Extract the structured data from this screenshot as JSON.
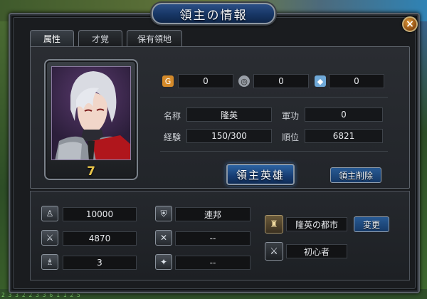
{
  "window": {
    "title": "領主の情報",
    "close_symbol": "×"
  },
  "background": {
    "corner_text": "2 3 3 2 2 3 3 6 1 1 2 5"
  },
  "tabs": [
    {
      "label": "属性",
      "active": true
    },
    {
      "label": "才覚",
      "active": false
    },
    {
      "label": "保有領地",
      "active": false
    }
  ],
  "portrait": {
    "level": "7"
  },
  "resources": [
    {
      "icon": "gold-coin-icon",
      "value": "0"
    },
    {
      "icon": "stone-icon",
      "value": "0"
    },
    {
      "icon": "crystal-icon",
      "value": "0"
    }
  ],
  "info": {
    "name_label": "名称",
    "name_value": "隆英",
    "merit_label": "軍功",
    "merit_value": "0",
    "exp_label": "経験",
    "exp_value": "150/300",
    "rank_label": "順位",
    "rank_value": "6821"
  },
  "buttons": {
    "main_hero": "領主英雄",
    "remove_lord": "領主削除",
    "change": "変更"
  },
  "stats_left": [
    {
      "icon": "soldier-icon",
      "value": "10000"
    },
    {
      "icon": "sword-icon",
      "value": "4870"
    },
    {
      "icon": "mage-icon",
      "value": "3"
    }
  ],
  "stats_mid": [
    {
      "icon": "alliance-shield-icon",
      "value": "連邦"
    },
    {
      "icon": "crossed-axes-icon",
      "value": "--"
    },
    {
      "icon": "emblem-icon",
      "value": "--"
    }
  ],
  "city": {
    "name": "隆英の都市",
    "title": "初心者"
  },
  "colors": {
    "accent_blue": "#1f4a82",
    "level_gold": "#e8c44a",
    "frame_gray": "#5a6068"
  }
}
